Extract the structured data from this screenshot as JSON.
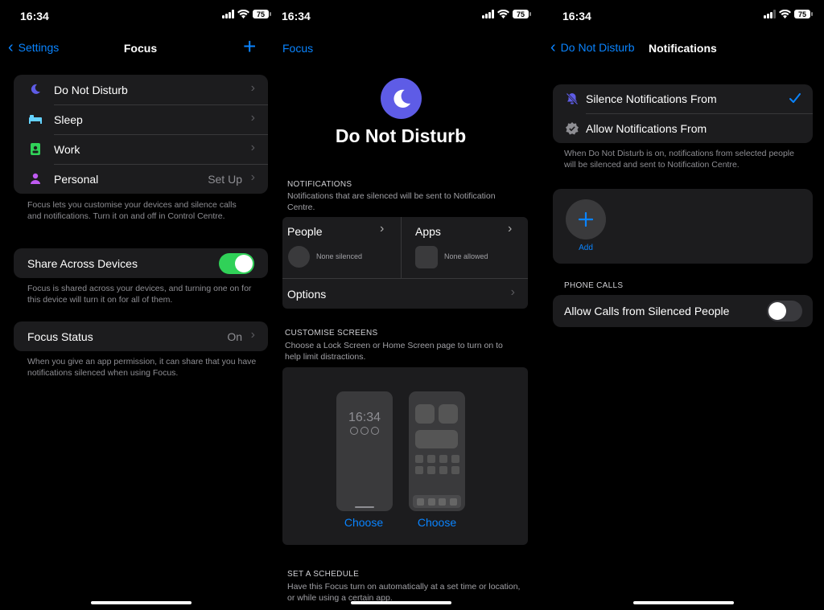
{
  "status": {
    "time": "16:34",
    "battery": "75"
  },
  "screen1": {
    "back": "Settings",
    "title": "Focus",
    "add_glyph": "+",
    "modes": [
      {
        "label": "Do Not Disturb",
        "value": "",
        "icon": "moon-icon",
        "color": "#5e5ce6"
      },
      {
        "label": "Sleep",
        "value": "",
        "icon": "bed-icon",
        "color": "#64d2ff"
      },
      {
        "label": "Work",
        "value": "",
        "icon": "id-badge-icon",
        "color": "#30d158"
      },
      {
        "label": "Personal",
        "value": "Set Up",
        "icon": "person-icon",
        "color": "#bf5af2"
      }
    ],
    "modes_note": "Focus lets you customise your devices and silence calls and notifications. Turn it on and off in Control Centre.",
    "share_label": "Share Across Devices",
    "share_on": true,
    "share_note": "Focus is shared across your devices, and turning one on for this device will turn it on for all of them.",
    "status_label": "Focus Status",
    "status_value": "On",
    "status_note": "When you give an app permission, it can share that you have notifications silenced when using Focus."
  },
  "screen2": {
    "back": "Focus",
    "title": "Do Not Disturb",
    "notifications_header": "NOTIFICATIONS",
    "notifications_note": "Notifications that are silenced will be sent to Notification Centre.",
    "people_label": "People",
    "people_sub": "None silenced",
    "apps_label": "Apps",
    "apps_sub": "None allowed",
    "options_label": "Options",
    "customise_header": "CUSTOMISE SCREENS",
    "customise_note": "Choose a Lock Screen or Home Screen page to turn on to help limit distractions.",
    "lock_time": "16:34",
    "choose_lock": "Choose",
    "choose_home": "Choose",
    "schedule_header": "SET A SCHEDULE",
    "schedule_note": "Have this Focus turn on automatically at a set time or location, or while using a certain app."
  },
  "screen3": {
    "back": "Do Not Disturb",
    "title": "Notifications",
    "silence_label": "Silence Notifications From",
    "allow_label": "Allow Notifications From",
    "mode_note": "When Do Not Disturb is on, notifications from selected people will be silenced and sent to Notification Centre.",
    "add_label": "Add",
    "phone_calls_header": "PHONE CALLS",
    "allow_calls_label": "Allow Calls from Silenced People",
    "allow_calls_on": false
  },
  "colors": {
    "accent": "#0a84ff",
    "toggle_on": "#30d158",
    "group_bg": "#1c1c1e"
  }
}
